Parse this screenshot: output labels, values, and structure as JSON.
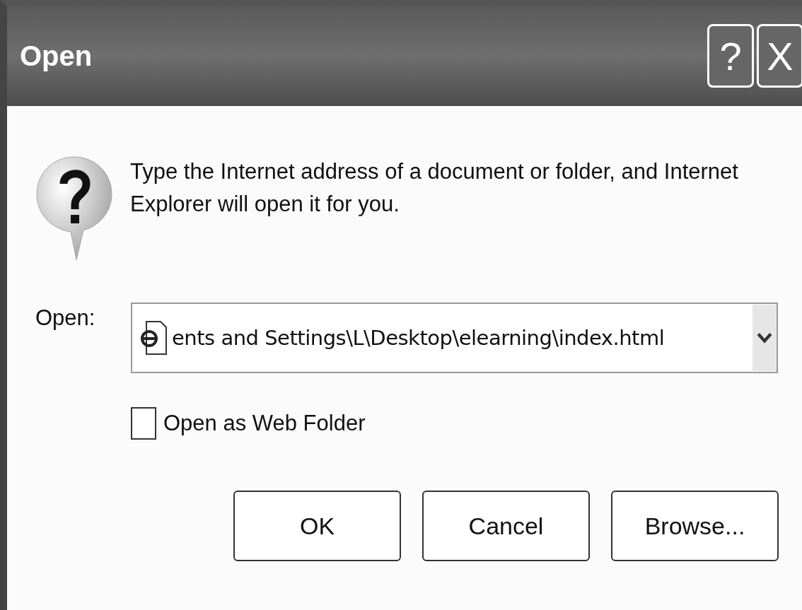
{
  "window": {
    "title": "Open",
    "title_buttons": [
      "?",
      "X"
    ]
  },
  "message": "Type the Internet address of a document or folder, and Internet Explorer will open it for you.",
  "open_field": {
    "label": "Open:",
    "value": "ents and Settings\\L\\Desktop\\elearning\\index.html"
  },
  "web_folder": {
    "label": "Open as Web Folder",
    "checked": false
  },
  "buttons": [
    "OK",
    "Cancel",
    "Browse..."
  ]
}
